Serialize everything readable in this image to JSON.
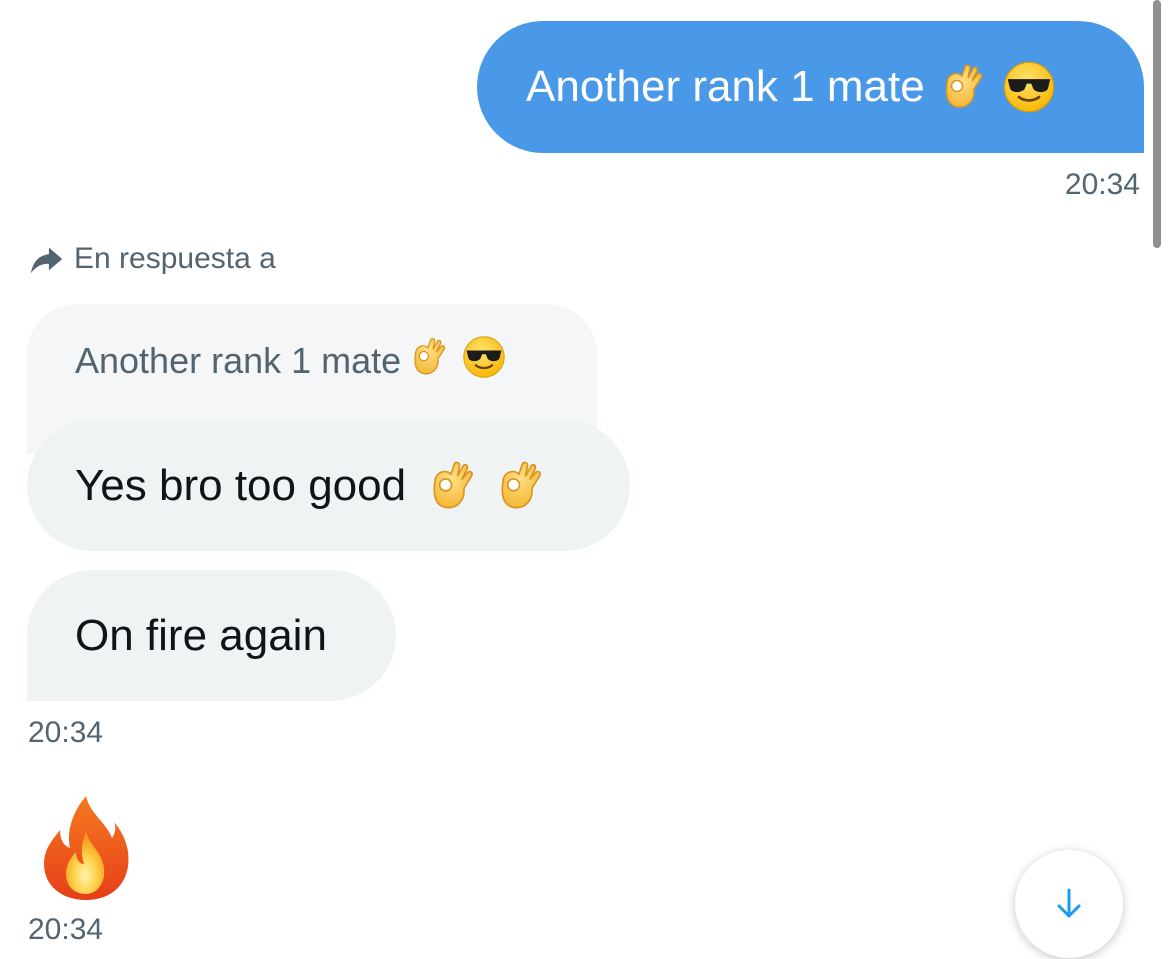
{
  "messages": {
    "sent": {
      "text": "Another rank 1 mate",
      "emojis": [
        "ok-hand",
        "sunglasses-face"
      ],
      "time": "20:34"
    },
    "reply_label": "En respuesta a",
    "quoted": {
      "text": "Another rank 1 mate",
      "emojis": [
        "ok-hand",
        "sunglasses-face"
      ]
    },
    "received": [
      {
        "text": "Yes bro too good",
        "emojis": [
          "ok-hand",
          "ok-hand"
        ]
      },
      {
        "text": "On fire again",
        "emojis": []
      }
    ],
    "received_time": "20:34",
    "fire": {
      "emoji": "fire",
      "time": "20:34"
    }
  },
  "colors": {
    "sent_bubble": "#4a99e9",
    "received_bubble": "#eff3f4",
    "secondary_text": "#536471",
    "accent": "#1d9bf0"
  },
  "icons": {
    "reply": "reply-arrow-icon",
    "scroll_down": "arrow-down-icon"
  }
}
